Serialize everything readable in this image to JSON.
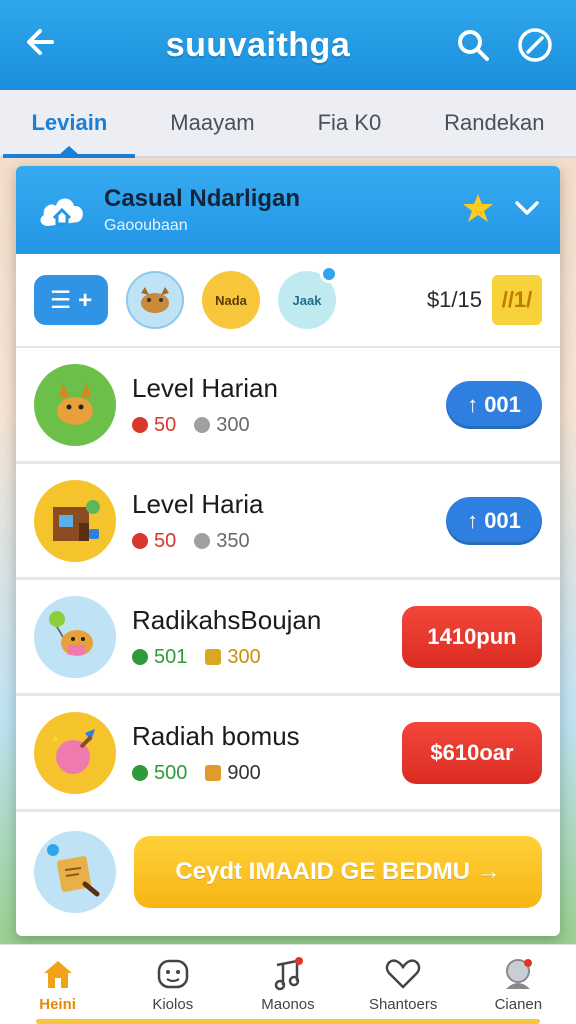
{
  "header": {
    "title": "suuvaithga"
  },
  "tabs": [
    {
      "label": "Leviain",
      "active": true
    },
    {
      "label": "Maayam"
    },
    {
      "label": "Fia K0"
    },
    {
      "label": "Randekan"
    }
  ],
  "card": {
    "title": "Casual Ndarligan",
    "subtitle": "Gaooubaan",
    "filters": {
      "list_label": "☰ +",
      "chip_yellow": "Nada",
      "chip_teal": "Jaak",
      "price": "$1/15",
      "price_badge": "//1/"
    },
    "rows": [
      {
        "name": "Level Harian",
        "stat1": "50",
        "stat2": "300",
        "action": "↑ 001",
        "action_style": "blue"
      },
      {
        "name": "Level Haria",
        "stat1": "50",
        "stat2": "350",
        "action": "↑ 001",
        "action_style": "blue"
      },
      {
        "name": "RadikahsBoujan",
        "stat1": "501",
        "stat2": "300",
        "action": "1410pun",
        "action_style": "red"
      },
      {
        "name": "Radiah bomus",
        "stat1": "500",
        "stat2": "900",
        "action": "$610oar",
        "action_style": "red"
      }
    ],
    "bonus_button": "Ceydt IMAAID GE BEDMU →"
  },
  "bottom_nav": [
    {
      "label": "Heini",
      "active": true
    },
    {
      "label": "Kiolos"
    },
    {
      "label": "Maonos"
    },
    {
      "label": "Shantoers"
    },
    {
      "label": "Cianen"
    }
  ],
  "colors": {
    "primary": "#1b8fdc",
    "accent_blue": "#2f7fe0",
    "accent_red": "#e0342a",
    "accent_yellow": "#f7c63a"
  }
}
